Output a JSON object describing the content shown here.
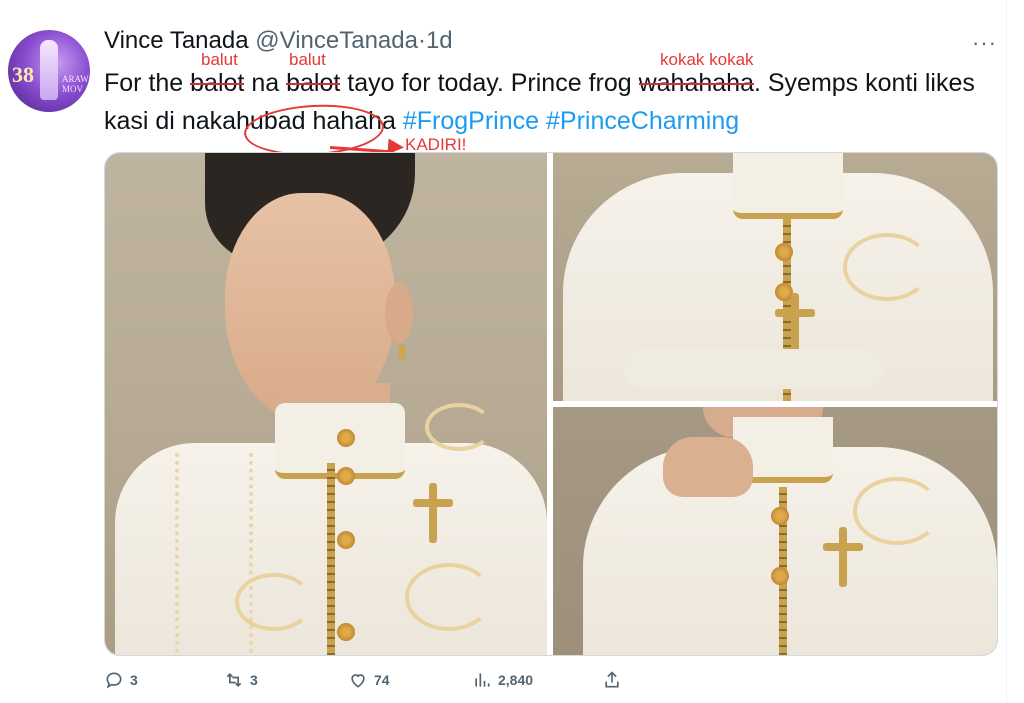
{
  "tweet": {
    "author_name": "Vince Tanada",
    "handle": "@VinceTanada",
    "separator": "·",
    "time": "1d",
    "more": "···",
    "avatar_text": "38",
    "avatar_small": "ARAW\nMOV",
    "text_parts": {
      "p1": "For the ",
      "w1": "balot",
      "p2": " na ",
      "w2": "balot",
      "p3": " tayo for today. Prince frog ",
      "w3": "wahahaha",
      "p4": ". Syemps konti likes kasi di ",
      "w4": "nakahubad",
      "p5": " hahaha ",
      "h1": "#FrogPrince",
      "p6": " ",
      "h2": "#PrinceCharming"
    }
  },
  "annotations": {
    "a1": "balut",
    "a2": "balut",
    "a3": "kokak kokak",
    "a4": "KADIRI!",
    "color": "#e53935"
  },
  "actions": {
    "reply_count": "3",
    "retweet_count": "3",
    "like_count": "74",
    "views_count": "2,840"
  },
  "colors": {
    "hashtag": "#1d9bf0",
    "muted": "#536471"
  }
}
